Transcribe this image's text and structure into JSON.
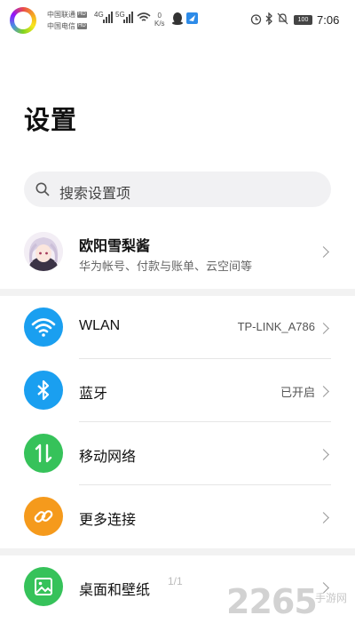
{
  "status_bar": {
    "carrier1": "中国联通",
    "carrier2": "中国电信",
    "hd": "HD",
    "net1": "4G",
    "net2": "5G",
    "speed_value": "0",
    "speed_unit": "K/s",
    "battery": "100",
    "time": "7:06"
  },
  "page": {
    "title": "设置"
  },
  "search": {
    "placeholder": "搜索设置项"
  },
  "account": {
    "name": "欧阳雪梨酱",
    "subtitle": "华为帐号、付款与账单、云空间等"
  },
  "groups": [
    {
      "items": [
        {
          "label": "WLAN",
          "value": "TP-LINK_A786",
          "icon": "wifi-icon",
          "color": "#1a9ff0"
        },
        {
          "label": "蓝牙",
          "value": "已开启",
          "icon": "bluetooth-icon",
          "color": "#1a9ff0"
        },
        {
          "label": "移动网络",
          "value": "",
          "icon": "mobile-data-icon",
          "color": "#36c25a"
        },
        {
          "label": "更多连接",
          "value": "",
          "icon": "link-icon",
          "color": "#f59a1c"
        }
      ]
    },
    {
      "items": [
        {
          "label": "桌面和壁纸",
          "value": "",
          "icon": "wallpaper-icon",
          "color": "#36c25a"
        }
      ]
    }
  ],
  "overlay": {
    "page_indicator": "1/1",
    "watermark": "2265",
    "watermark_sub": "手游网"
  }
}
